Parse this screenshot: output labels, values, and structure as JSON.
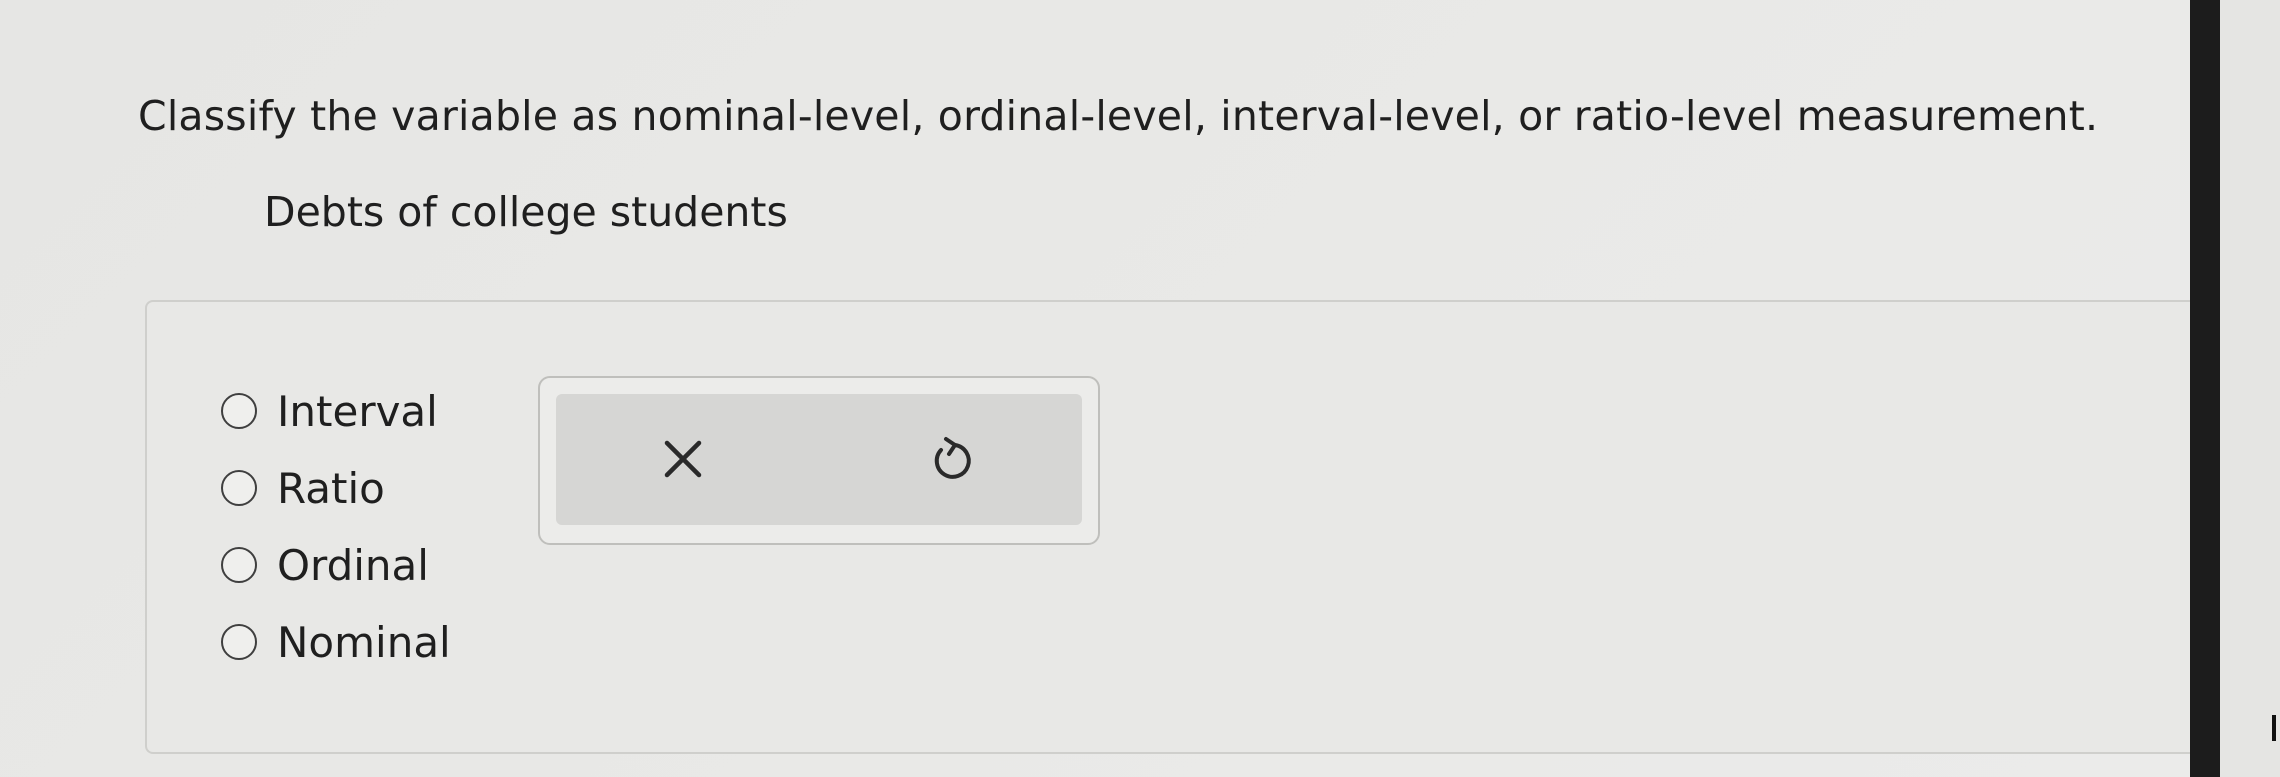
{
  "question": {
    "prompt": "Classify the variable as nominal-level, ordinal-level, interval-level, or ratio-level measurement.",
    "variable": "Debts of college students"
  },
  "options": [
    {
      "label": "Interval",
      "selected": false
    },
    {
      "label": "Ratio",
      "selected": false
    },
    {
      "label": "Ordinal",
      "selected": false
    },
    {
      "label": "Nominal",
      "selected": false
    }
  ],
  "tools": {
    "clear_icon": "close-icon",
    "undo_icon": "undo-icon"
  }
}
